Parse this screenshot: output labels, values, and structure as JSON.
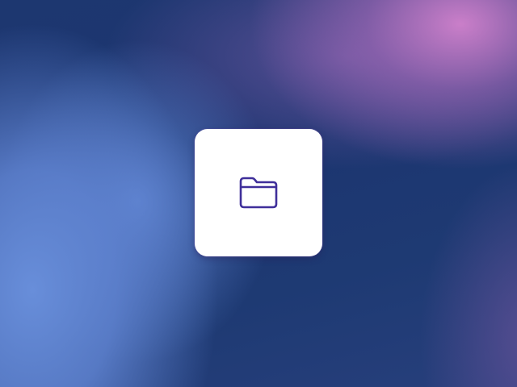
{
  "desktop": {
    "background_colors": [
      "#1d3570",
      "#d282cd",
      "#688ed6",
      "#5e5096"
    ]
  },
  "tile": {
    "icon": "folder-icon",
    "icon_color": "#3f2f9a",
    "background": "#ffffff"
  }
}
